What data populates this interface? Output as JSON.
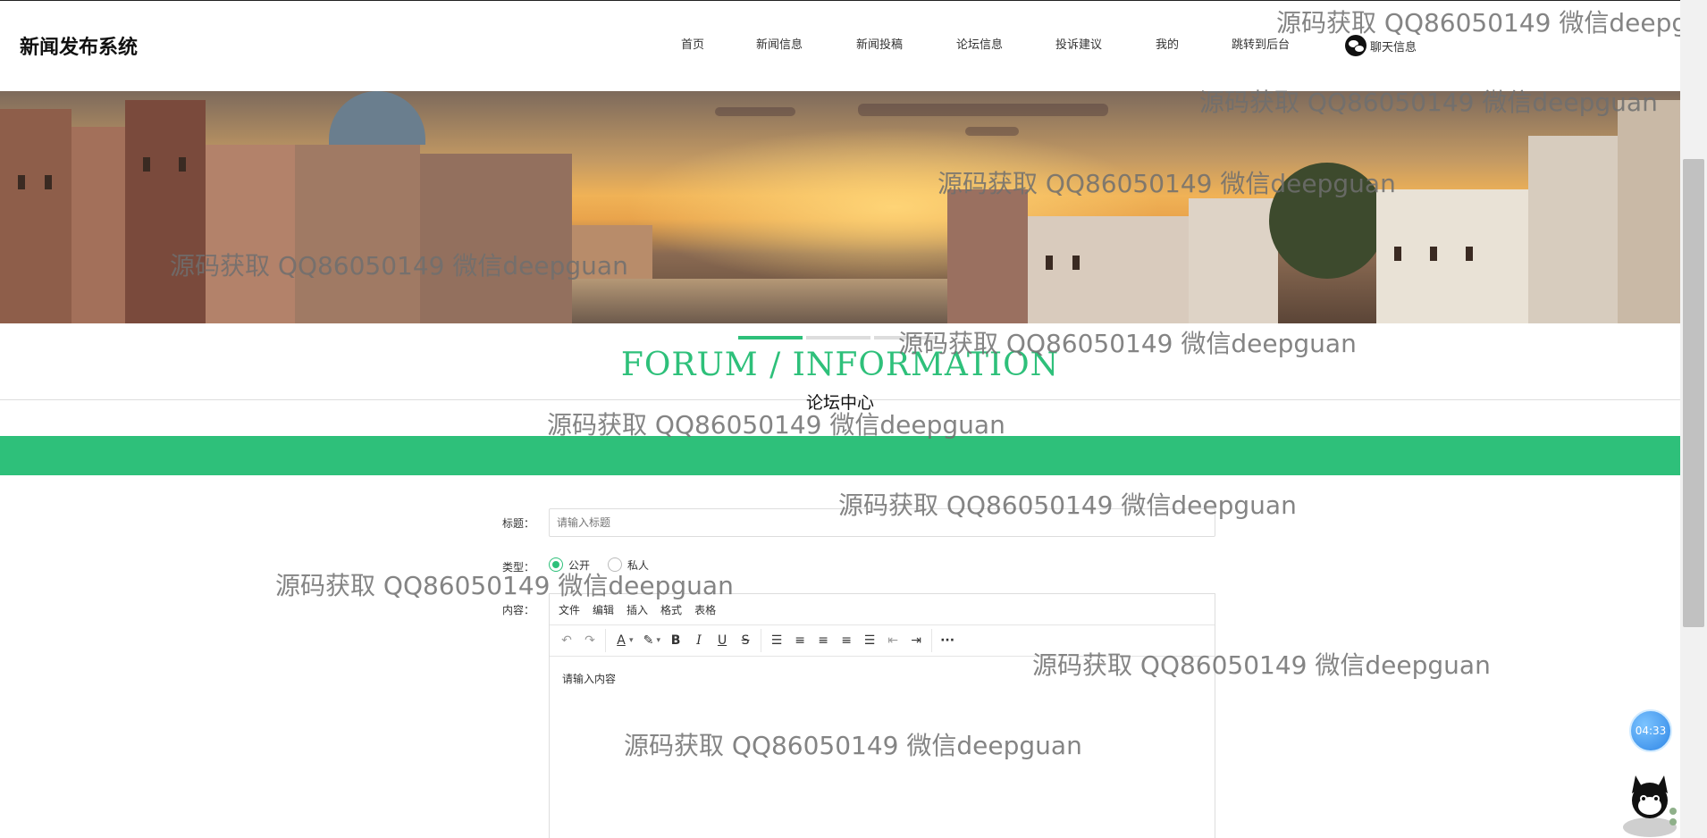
{
  "header": {
    "site_title": "新闻发布系统",
    "nav": [
      {
        "label": "首页"
      },
      {
        "label": "新闻信息"
      },
      {
        "label": "新闻投稿"
      },
      {
        "label": "论坛信息"
      },
      {
        "label": "投诉建议"
      },
      {
        "label": "我的"
      },
      {
        "label": "跳转到后台"
      }
    ],
    "chat_label": "聊天信息"
  },
  "section": {
    "title_en": "FORUM / INFORMATION",
    "title_cn": "论坛中心"
  },
  "form": {
    "title_label": "标题：",
    "title_placeholder": "请输入标题",
    "type_label": "类型：",
    "type_options": [
      {
        "label": "公开",
        "checked": true
      },
      {
        "label": "私人",
        "checked": false
      }
    ],
    "content_label": "内容：",
    "editor_menu": [
      "文件",
      "编辑",
      "插入",
      "格式",
      "表格"
    ],
    "editor_placeholder": "请输入内容"
  },
  "timer": "04:33",
  "watermark": "源码获取 QQ86050149 微信deepguan",
  "colors": {
    "accent": "#2ec07a"
  }
}
